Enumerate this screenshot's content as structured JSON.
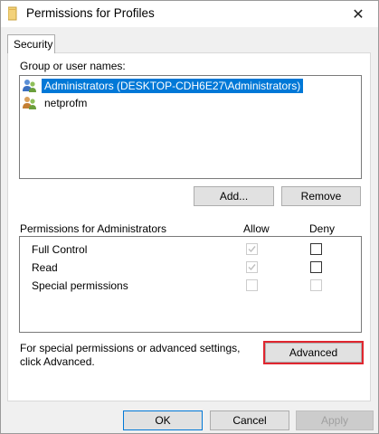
{
  "window": {
    "title": "Permissions for Profiles",
    "close_glyph": "✕"
  },
  "tabs": [
    {
      "label": "Security",
      "active": true
    }
  ],
  "group_section": {
    "label": "Group or user names:",
    "users": [
      {
        "name": "Administrators (DESKTOP-CDH6E27\\Administrators)",
        "selected": true,
        "icon": "users-group-icon"
      },
      {
        "name": "netprofm",
        "selected": false,
        "icon": "users-group-icon"
      }
    ],
    "add_label": "Add...",
    "remove_label": "Remove"
  },
  "permissions": {
    "label": "Permissions for Administrators",
    "allow_header": "Allow",
    "deny_header": "Deny",
    "rows": [
      {
        "name": "Full Control",
        "allow": true,
        "allow_disabled": true,
        "deny": false,
        "deny_disabled": false
      },
      {
        "name": "Read",
        "allow": true,
        "allow_disabled": true,
        "deny": false,
        "deny_disabled": false
      },
      {
        "name": "Special permissions",
        "allow": false,
        "allow_disabled": true,
        "deny": false,
        "deny_disabled": true
      }
    ]
  },
  "advanced": {
    "text_line1": "For special permissions or advanced settings,",
    "text_line2": "click Advanced.",
    "button_label": "Advanced"
  },
  "footer": {
    "ok_label": "OK",
    "cancel_label": "Cancel",
    "apply_label": "Apply"
  },
  "colors": {
    "selection": "#0078d7",
    "highlight_border": "#e0262f",
    "folder": "#e8c35a"
  }
}
